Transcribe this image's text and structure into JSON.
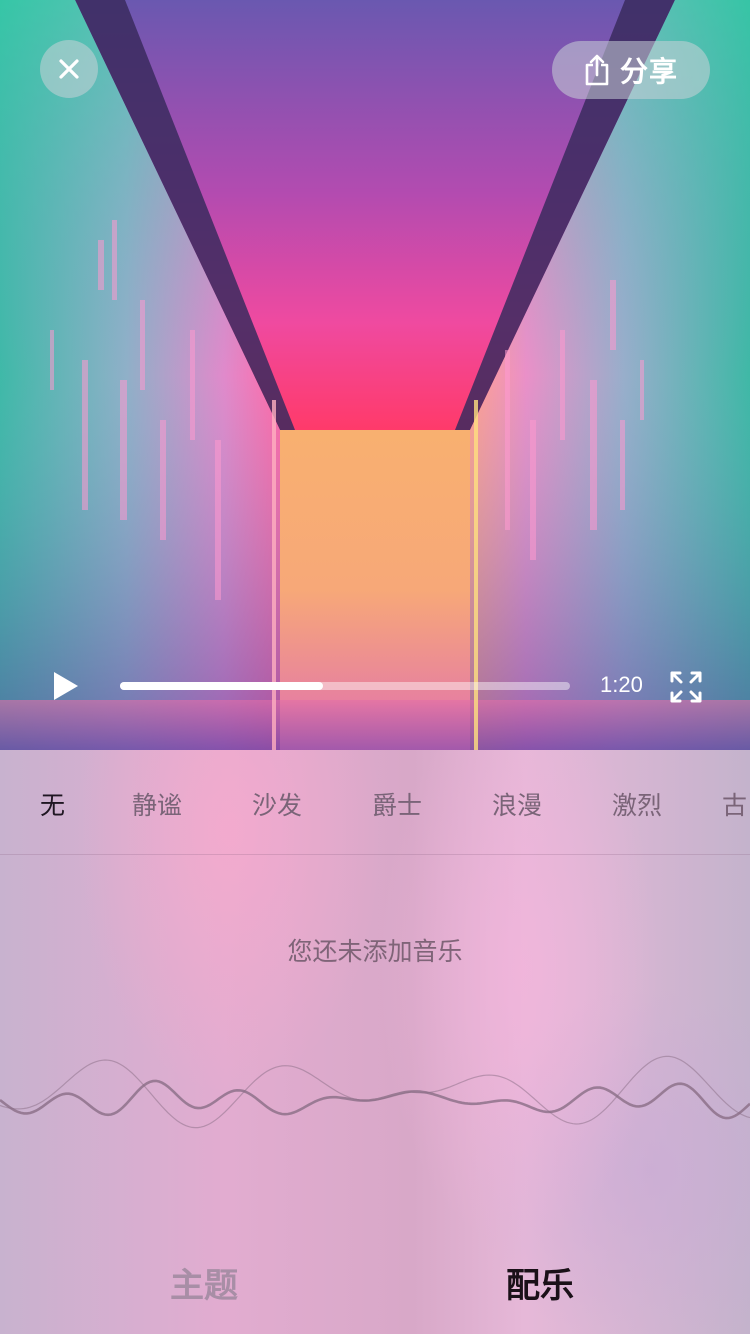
{
  "header": {
    "close_icon": "close-icon",
    "share_icon": "share-icon",
    "share_label": "分享"
  },
  "player": {
    "state": "paused",
    "progress_fraction": 0.45,
    "time": "1:20",
    "play_icon": "play-icon",
    "fullscreen_icon": "fullscreen-icon"
  },
  "music_filters": [
    {
      "label": "无",
      "active": true
    },
    {
      "label": "静谧",
      "active": false
    },
    {
      "label": "沙发",
      "active": false
    },
    {
      "label": "爵士",
      "active": false
    },
    {
      "label": "浪漫",
      "active": false
    },
    {
      "label": "激烈",
      "active": false
    },
    {
      "label": "古",
      "active": false
    }
  ],
  "music": {
    "empty_message": "您还未添加音乐"
  },
  "bottom_tabs": [
    {
      "label": "主题",
      "active": false
    },
    {
      "label": "配乐",
      "active": true
    }
  ],
  "colors": {
    "active_tab": "#1a1018",
    "inactive_tab": "#a88ea6",
    "progress_fill": "#ffffff"
  }
}
